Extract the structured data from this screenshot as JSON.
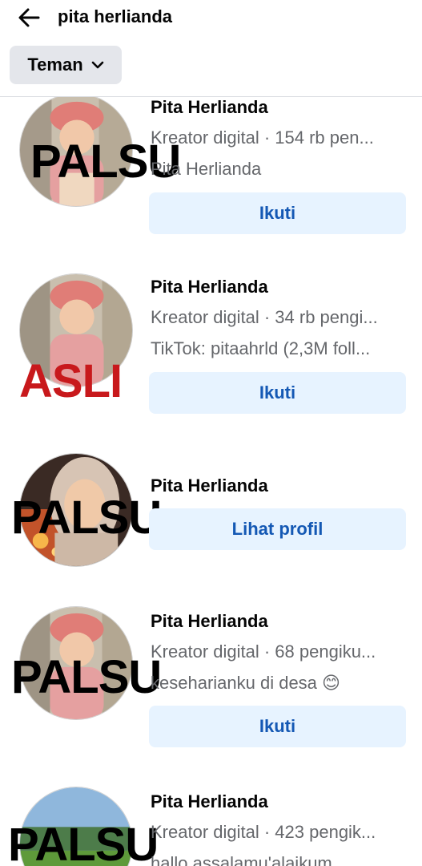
{
  "header": {
    "search_query": "pita herlianda"
  },
  "filter": {
    "label": "Teman"
  },
  "colors": {
    "stamp_palsu": "#000000",
    "stamp_asli": "#c8191c",
    "button_bg": "#e7f3ff",
    "button_text": "#1458b4"
  },
  "results": [
    {
      "name": "Pita Herlianda",
      "line1": "Kreator digital · 154 rb pen...",
      "line2": "Pita Herlianda",
      "button": "Ikuti",
      "stamp": "PALSU"
    },
    {
      "name": "Pita Herlianda",
      "line1": "Kreator digital · 34 rb pengi...",
      "line2": "TikTok: pitaahrld (2,3M foll...",
      "button": "Ikuti",
      "stamp": "ASLI"
    },
    {
      "name": "Pita Herlianda",
      "button": "Lihat profil",
      "stamp": "PALSU"
    },
    {
      "name": "Pita Herlianda",
      "line1": "Kreator digital · 68 pengiku...",
      "line2": "keseharianku di desa 😊",
      "button": "Ikuti",
      "stamp": "PALSU"
    },
    {
      "name": "Pita Herlianda",
      "line1": "Kreator digital · 423 pengik...",
      "line2": "hallo assalamu'alaikum",
      "stamp": "PALSU"
    }
  ]
}
